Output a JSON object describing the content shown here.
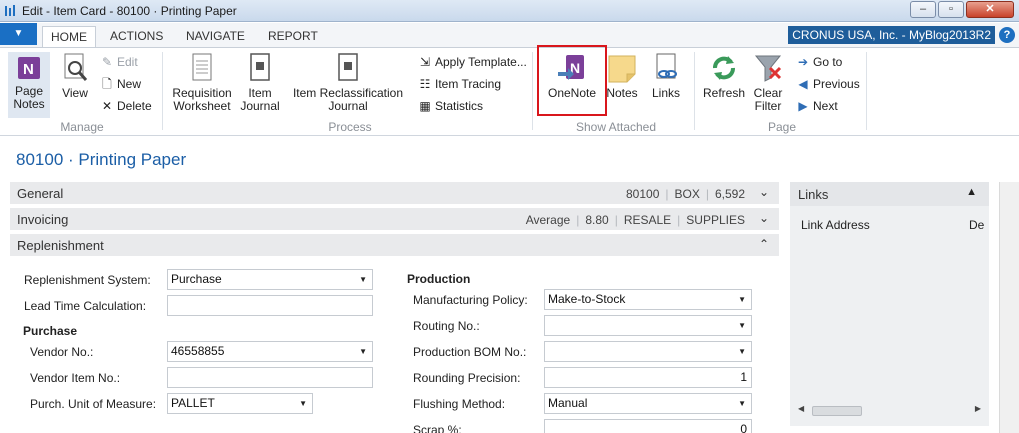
{
  "window": {
    "title": "Edit - Item Card - 80100 · Printing Paper",
    "minimize": "–",
    "restore": "▫",
    "close": "✕"
  },
  "ribbon_tabs": [
    {
      "label": "HOME"
    },
    {
      "label": "ACTIONS"
    },
    {
      "label": "NAVIGATE"
    },
    {
      "label": "REPORT"
    }
  ],
  "company": "CRONUS USA, Inc. - MyBlog2013R2",
  "ribbon": {
    "manage": {
      "label": "Manage",
      "page_notes": "Page Notes",
      "view": "View",
      "edit": "Edit",
      "new": "New",
      "delete": "Delete"
    },
    "process": {
      "label": "Process",
      "requisition_worksheet": "Requisition Worksheet",
      "item_journal": "Item Journal",
      "item_reclass": "Item Reclassification Journal",
      "apply_template": "Apply Template...",
      "item_tracing": "Item Tracing",
      "statistics": "Statistics"
    },
    "show_attached": {
      "label": "Show Attached",
      "onenote": "OneNote",
      "notes": "Notes",
      "links": "Links"
    },
    "page": {
      "label": "Page",
      "refresh": "Refresh",
      "clear_filter": "Clear Filter",
      "go_to": "Go to",
      "previous": "Previous",
      "next": "Next"
    }
  },
  "page_title": "80100 · Printing Paper",
  "fasttabs": {
    "general": {
      "title": "General",
      "summary": [
        "80100",
        "BOX",
        "6,592"
      ]
    },
    "invoicing": {
      "title": "Invoicing",
      "summary": [
        "Average",
        "8.80",
        "RESALE",
        "SUPPLIES"
      ]
    },
    "replenishment": {
      "title": "Replenishment"
    }
  },
  "replenishment": {
    "replenishment_system": {
      "label": "Replenishment System:",
      "value": "Purchase"
    },
    "lead_time": {
      "label": "Lead Time Calculation:",
      "value": ""
    },
    "purchase_header": "Purchase",
    "vendor_no": {
      "label": "Vendor No.:",
      "value": "46558855"
    },
    "vendor_item_no": {
      "label": "Vendor Item No.:",
      "value": ""
    },
    "purch_uom": {
      "label": "Purch. Unit of Measure:",
      "value": "PALLET"
    },
    "production_header": "Production",
    "manufacturing_policy": {
      "label": "Manufacturing Policy:",
      "value": "Make-to-Stock"
    },
    "routing_no": {
      "label": "Routing No.:",
      "value": ""
    },
    "production_bom": {
      "label": "Production BOM No.:",
      "value": ""
    },
    "rounding_precision": {
      "label": "Rounding Precision:",
      "value": "1"
    },
    "flushing_method": {
      "label": "Flushing Method:",
      "value": "Manual"
    },
    "scrap": {
      "label": "Scrap %:",
      "value": "0"
    }
  },
  "links_panel": {
    "title": "Links",
    "col_address": "Link Address",
    "col_desc": "De"
  },
  "colors": {
    "accent": "#1b5ea6",
    "highlight_box": "#d9161c",
    "onenote_purple": "#7b3f99"
  }
}
